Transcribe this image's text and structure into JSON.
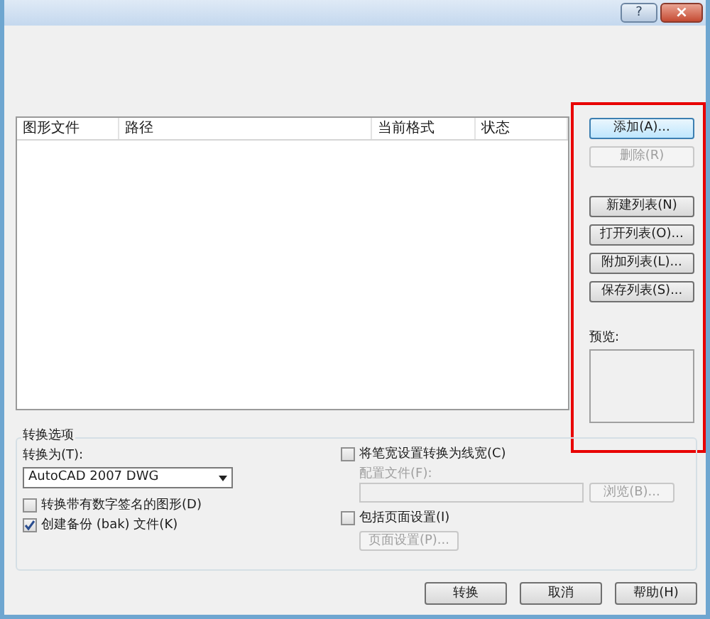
{
  "title_bar": {
    "buttons": [
      {
        "kind": "help",
        "label": "?"
      },
      {
        "kind": "close",
        "label": "×"
      }
    ]
  },
  "file_table": {
    "columns": [
      "图形文件",
      "路径",
      "当前格式",
      "状态"
    ]
  },
  "side_buttons": [
    {
      "label": "添加(A)...",
      "disabled": false,
      "focused": true
    },
    {
      "label": "删除(R)",
      "disabled": true,
      "focused": false
    },
    {
      "label": "新建列表(N)",
      "disabled": false,
      "focused": false
    },
    {
      "label": "打开列表(O)...",
      "disabled": false,
      "focused": false
    },
    {
      "label": "附加列表(L)...",
      "disabled": false,
      "focused": false
    },
    {
      "label": "保存列表(S)...",
      "disabled": false,
      "focused": false
    }
  ],
  "preview": {
    "label": "预览:"
  },
  "options": {
    "title": "转换选项",
    "convert_to_label": "转换为(T):",
    "convert_to_value": "AutoCAD 2007 DWG",
    "left_checks": [
      {
        "label": "转换带有数字签名的图形(D)",
        "checked": false
      },
      {
        "label": "创建备份 (bak) 文件(K)",
        "checked": true
      }
    ],
    "pen_check": {
      "label": "将笔宽设置转换为线宽(C)",
      "checked": false
    },
    "profile_label": "配置文件(F):",
    "browse_button": "浏览(B)...",
    "page_check": {
      "label": "包括页面设置(I)",
      "checked": false
    },
    "page_setup_button": "页面设置(P)..."
  },
  "footer_buttons": [
    "转换",
    "取消",
    "帮助(H)"
  ]
}
